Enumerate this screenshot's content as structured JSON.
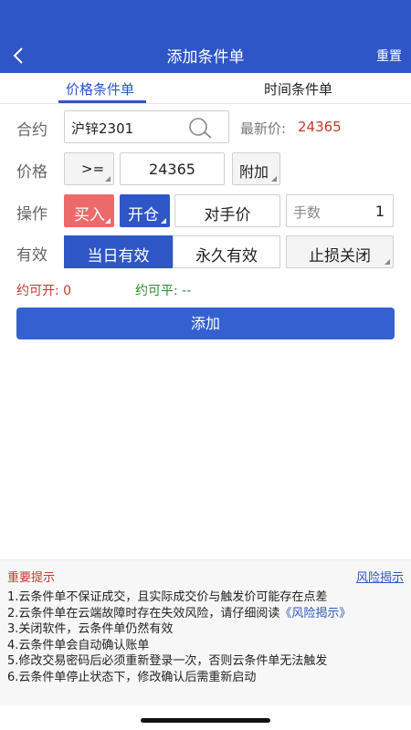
{
  "header": {
    "title": "添加条件单",
    "reset_label": "重置"
  },
  "tabs": {
    "price": "价格条件单",
    "time": "时间条件单"
  },
  "form": {
    "contract_label": "合约",
    "contract_value": "沪锌2301",
    "latest_label": "最新价:",
    "latest_value": "24365",
    "price_label": "价格",
    "operator": ">=",
    "price_value": "24365",
    "extra_label": "附加",
    "action_label": "操作",
    "buy_label": "买入",
    "open_label": "开仓",
    "counterparty_label": "对手价",
    "qty_label": "手数",
    "qty_value": "1",
    "valid_label": "有效",
    "valid_today": "当日有效",
    "valid_forever": "永久有效",
    "stoploss_label": "止损关闭",
    "can_open": "约可开: 0",
    "can_close": "约可平: --",
    "add_button": "添加"
  },
  "notice": {
    "title": "重要提示",
    "risk_link": "风险揭示",
    "line1": "1.云条件单不保证成交，且实际成交价与触发价可能存在点差",
    "line2_prefix": "2.云条件单在云端故障时存在失效风险，请仔细阅读",
    "line2_link": "《风险揭示》",
    "line3": "3.关闭软件，云条件单仍然有效",
    "line4": "4.云条件单会自动确认账单",
    "line5": "5.修改交易密码后必须重新登录一次，否则云条件单无法触发",
    "line6": "6.云条件单停止状态下，修改确认后需重新启动"
  },
  "colors": {
    "primary": "#2f56c6",
    "buy": "#ec6a6a",
    "price_red": "#c0392b",
    "green": "#2e8b2e"
  }
}
